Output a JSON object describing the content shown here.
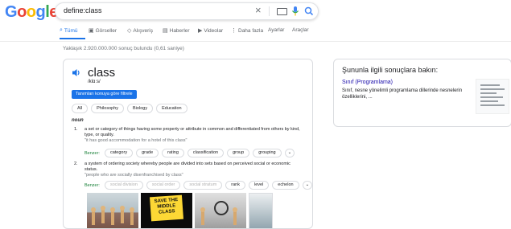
{
  "logo": [
    "G",
    "o",
    "o",
    "g",
    "l",
    "e"
  ],
  "logo_colors": [
    "#4285f4",
    "#ea4335",
    "#fbbc05",
    "#4285f4",
    "#34a853",
    "#ea4335"
  ],
  "search": {
    "query": "define:class",
    "clear_icon": "×"
  },
  "tabs": [
    {
      "label": "Tümü",
      "icon": "search-icon"
    },
    {
      "label": "Görseller",
      "icon": "image-icon"
    },
    {
      "label": "Alışveriş",
      "icon": "tag-icon"
    },
    {
      "label": "Haberler",
      "icon": "news-icon"
    },
    {
      "label": "Videolar",
      "icon": "video-icon"
    },
    {
      "label": "Daha fazla",
      "icon": "more-icon"
    },
    {
      "label": "Ayarlar"
    },
    {
      "label": "Araçlar"
    }
  ],
  "stats": "Yaklaşık 2.920.000.000 sonuç bulundu (0,61 saniye)",
  "dictionary": {
    "word": "class",
    "phonetic": "/klɑːs/",
    "translate_button": "Tanımları konuya göre filtrele",
    "filters": [
      "All",
      "Philosophy",
      "Biology",
      "Education"
    ],
    "part_of_speech": "noun",
    "definitions": [
      {
        "number": "1.",
        "text": "a set or category of things having some property or attribute in common and differentiated from others by kind, type, or quality.",
        "example": "\"it has good accommodation for a hotel of this class\"",
        "similar_label": "Benzer:",
        "synonyms": [
          "category",
          "grade",
          "rating",
          "classification",
          "group",
          "grouping"
        ]
      },
      {
        "number": "2.",
        "text": "a system of ordering society whereby people are divided into sets based on perceived social or economic status.",
        "example": "\"people who are socially disenfranchised by class\"",
        "similar_label": "Benzer:",
        "synonyms": [
          "social division",
          "social order",
          "social stratum",
          "rank",
          "level",
          "echelon"
        ],
        "synonyms_dimmed": [
          true,
          true,
          true,
          false,
          false,
          false
        ]
      }
    ],
    "image_text": "SAVE THE MIDDLE CLASS"
  },
  "related": {
    "title": "Şununla ilgili sonuçlara bakın:",
    "link": "Sınıf (Programlama)",
    "description": "Sınıf, nesne yönelimli programlama dillerinde nesnelerin özelliklerini, ..."
  },
  "colors": {
    "accent": "#1a73e8",
    "link": "#1a0dab",
    "similar_green": "#188038"
  }
}
